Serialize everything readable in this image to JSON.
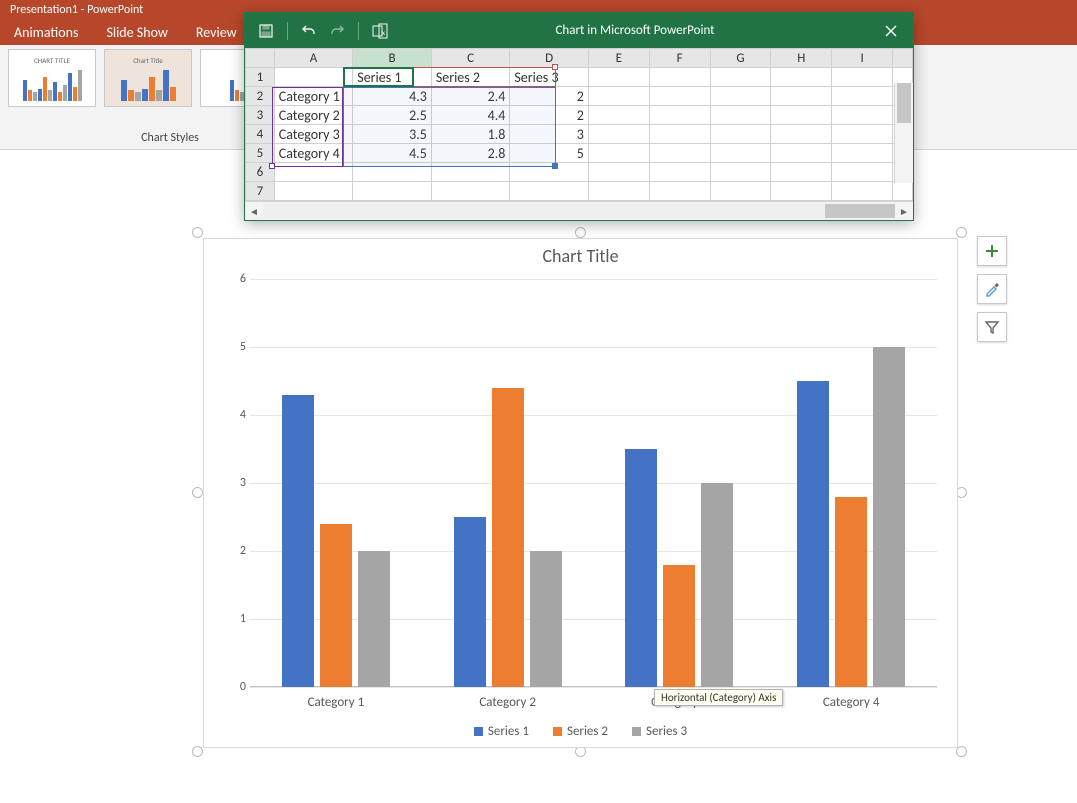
{
  "app_title": "Presentation1 - PowerPoint",
  "ribbon_tabs": [
    "Animations",
    "Slide Show",
    "Review"
  ],
  "styles_label": "Chart Styles",
  "excel": {
    "title": "Chart in Microsoft PowerPoint",
    "columns": [
      "A",
      "B",
      "C",
      "D",
      "E",
      "F",
      "G",
      "H",
      "I"
    ],
    "row_numbers": [
      "1",
      "2",
      "3",
      "4",
      "5",
      "6",
      "7"
    ],
    "headers": [
      "Series 1",
      "Series 2",
      "Series 3"
    ],
    "rows": [
      {
        "cat": "Category 1",
        "v": [
          "4.3",
          "2.4",
          "2"
        ]
      },
      {
        "cat": "Category 2",
        "v": [
          "2.5",
          "4.4",
          "2"
        ]
      },
      {
        "cat": "Category 3",
        "v": [
          "3.5",
          "1.8",
          "3"
        ]
      },
      {
        "cat": "Category 4",
        "v": [
          "4.5",
          "2.8",
          "5"
        ]
      }
    ]
  },
  "chart_data": {
    "type": "bar",
    "title": "Chart Title",
    "categories": [
      "Category 1",
      "Category 2",
      "Category 3",
      "Category 4"
    ],
    "series": [
      {
        "name": "Series 1",
        "values": [
          4.3,
          2.5,
          3.5,
          4.5
        ],
        "color": "#4472c4"
      },
      {
        "name": "Series 2",
        "values": [
          2.4,
          4.4,
          1.8,
          2.8
        ],
        "color": "#ed7d31"
      },
      {
        "name": "Series 3",
        "values": [
          2,
          2,
          3,
          5
        ],
        "color": "#a5a5a5"
      }
    ],
    "ylim": [
      0,
      6
    ],
    "yticks": [
      0,
      1,
      2,
      3,
      4,
      5,
      6
    ],
    "xlabel": "",
    "ylabel": ""
  },
  "tooltip": "Horizontal (Category) Axis",
  "legend": [
    "Series 1",
    "Series 2",
    "Series 3"
  ],
  "side_buttons": [
    "add-chart-element",
    "chart-styles-brush",
    "chart-filter"
  ]
}
